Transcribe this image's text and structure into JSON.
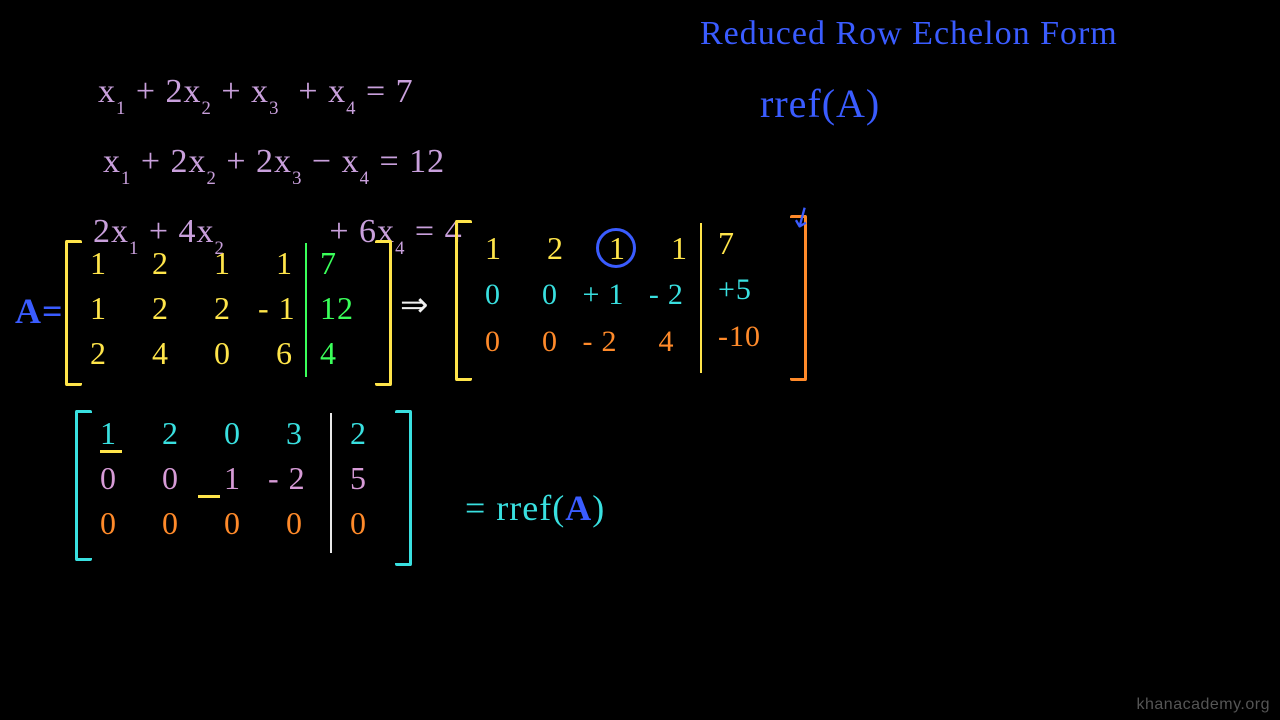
{
  "title": {
    "line1": "Reduced Row Echelon Form",
    "line2": "rref(A)"
  },
  "equations": {
    "eq1_pre": "x",
    "eq1": "x₁ + 2x₂ + x₃  + x₄ = 7",
    "eq2": "x₁ + 2x₂ + 2x₃ − x₄ = 12",
    "eq3": "2x₁ + 4x₂          + 6x₄ = 4"
  },
  "labelA": "A=",
  "matrixA": {
    "r1": "1  2  1  1",
    "r2": "1  2  2 -1",
    "r3": "2  4  0  6",
    "aug": {
      "r1": "7",
      "r2": "12",
      "r3": "4"
    }
  },
  "arrow1": "⇒",
  "matrixB": {
    "r1": "1  2  1  1",
    "r2": "0  0 +1 -2",
    "r3": "0  0 -2  4",
    "aug": {
      "r1": "7",
      "r2": "+5",
      "r3": "-10"
    }
  },
  "matrixC": {
    "r1": "1  2  0  3",
    "r2": "0  0  1 -2",
    "r3": "0  0  0  0",
    "aug": {
      "r1": "2",
      "r2": "5",
      "r3": "0"
    }
  },
  "rref_eq": "= rref(A)",
  "watermark": "khanacademy.org"
}
